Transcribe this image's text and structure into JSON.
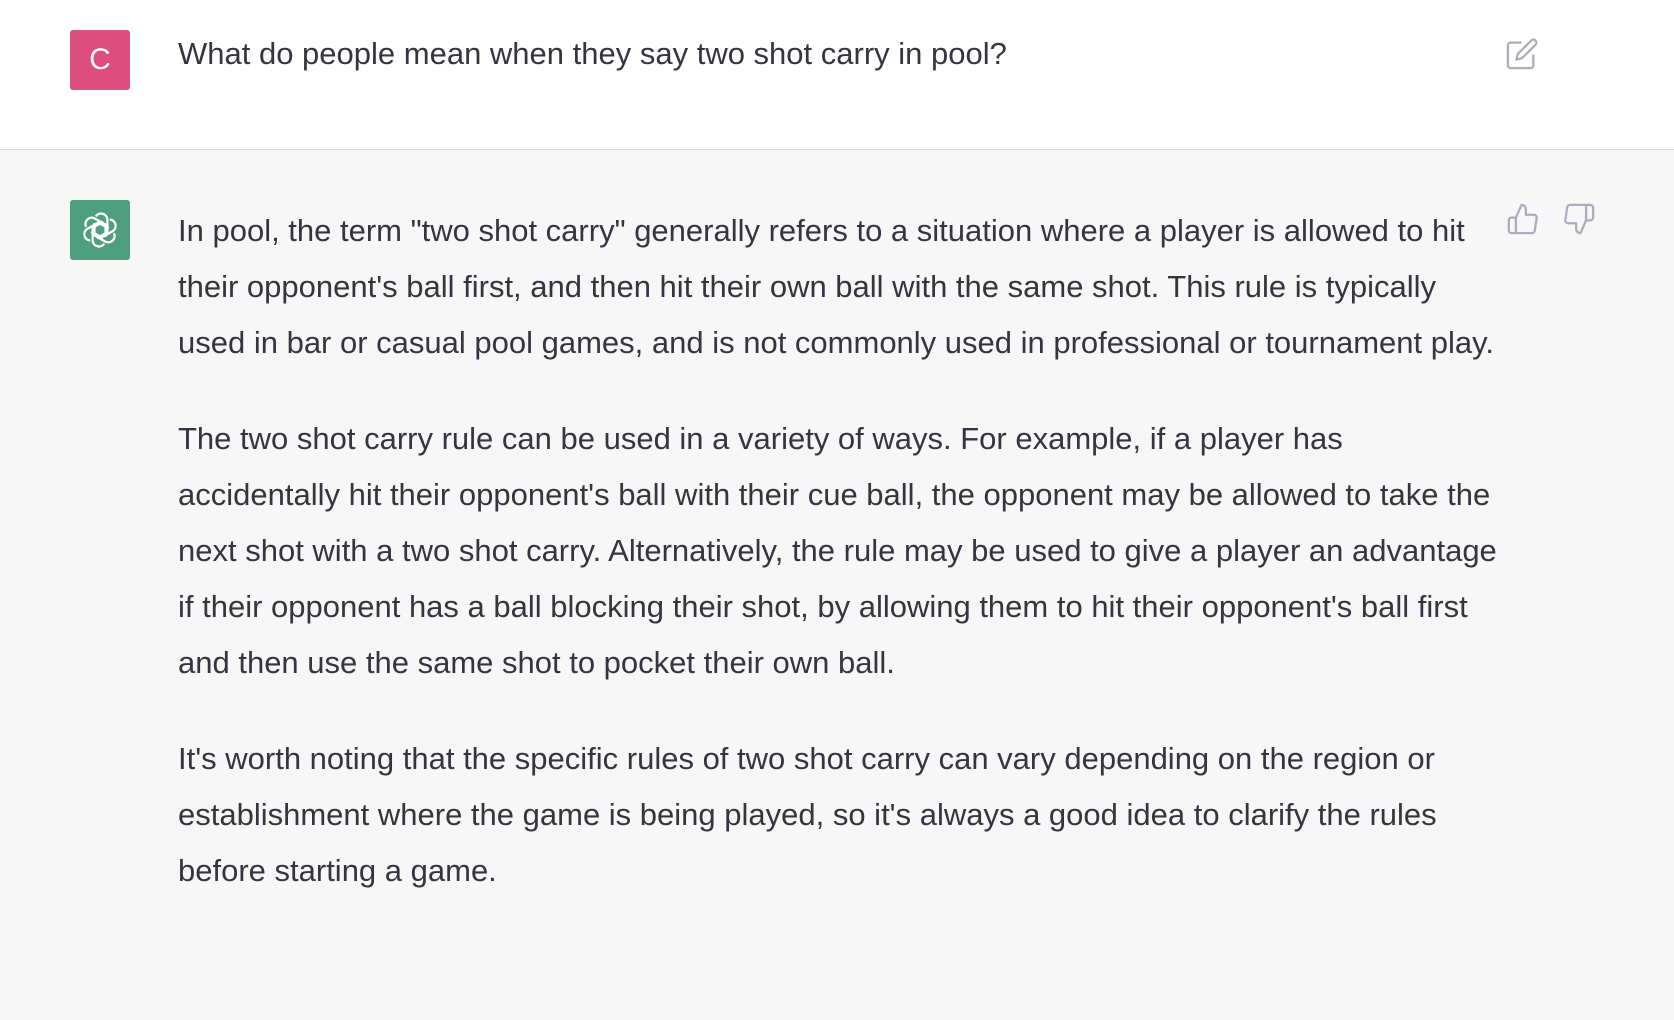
{
  "user_message": {
    "avatar_letter": "C",
    "avatar_color": "#dd4d7e",
    "text": "What do people mean when they say two shot carry in pool?"
  },
  "assistant_message": {
    "avatar_icon": "openai-logo-icon",
    "avatar_color": "#4f9e7f",
    "paragraphs": [
      "In pool, the term \"two shot carry\" generally refers to a situation where a player is allowed to hit their opponent's ball first, and then hit their own ball with the same shot. This rule is typically used in bar or casual pool games, and is not commonly used in professional or tournament play.",
      "The two shot carry rule can be used in a variety of ways. For example, if a player has accidentally hit their opponent's ball with their cue ball, the opponent may be allowed to take the next shot with a two shot carry. Alternatively, the rule may be used to give a player an advantage if their opponent has a ball blocking their shot, by allowing them to hit their opponent's ball first and then use the same shot to pocket their own ball.",
      "It's worth noting that the specific rules of two shot carry can vary depending on the region or establishment where the game is being played, so it's always a good idea to clarify the rules before starting a game."
    ]
  },
  "icons": {
    "edit": "edit-icon",
    "thumbs_up": "thumbs-up-icon",
    "thumbs_down": "thumbs-down-icon"
  }
}
